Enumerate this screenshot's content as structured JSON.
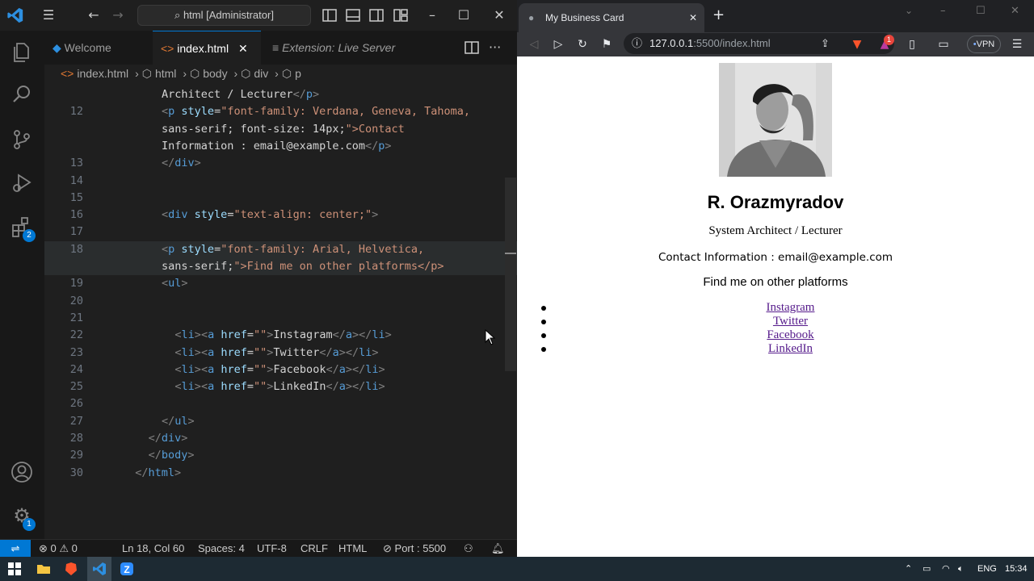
{
  "vscode": {
    "command_center": "html [Administrator]",
    "tabs": [
      {
        "label": "Welcome",
        "active": false
      },
      {
        "label": "index.html",
        "active": true
      },
      {
        "label": "Extension: Live Server",
        "active": false
      }
    ],
    "breadcrumb": [
      "index.html",
      "html",
      "body",
      "div",
      "p"
    ],
    "code_lines": [
      {
        "n": "",
        "text": "Architect / Lecturer</p>"
      },
      {
        "n": "12",
        "text": "<p style=\"font-family: Verdana, Geneva, Tahoma,"
      },
      {
        "n": "",
        "text": "sans-serif; font-size: 14px;\">Contact"
      },
      {
        "n": "",
        "text": "Information : email@example.com</p>"
      },
      {
        "n": "13",
        "text": "</div>"
      },
      {
        "n": "14",
        "text": ""
      },
      {
        "n": "15",
        "text": ""
      },
      {
        "n": "16",
        "text": "<div style=\"text-align: center;\">"
      },
      {
        "n": "17",
        "text": ""
      },
      {
        "n": "18",
        "text": "<p style=\"font-family: Arial, Helvetica,"
      },
      {
        "n": "",
        "text": "sans-serif;\">Find me on other platforms</p>"
      },
      {
        "n": "19",
        "text": "<ul>"
      },
      {
        "n": "20",
        "text": ""
      },
      {
        "n": "21",
        "text": ""
      },
      {
        "n": "22",
        "text": "<li><a href=\"\">Instagram</a></li>"
      },
      {
        "n": "23",
        "text": "<li><a href=\"\">Twitter</a></li>"
      },
      {
        "n": "24",
        "text": "<li><a href=\"\">Facebook</a></li>"
      },
      {
        "n": "25",
        "text": "<li><a href=\"\">LinkedIn</a></li>"
      },
      {
        "n": "26",
        "text": ""
      },
      {
        "n": "27",
        "text": "</ul>"
      },
      {
        "n": "28",
        "text": "</div>"
      },
      {
        "n": "29",
        "text": "</body>"
      },
      {
        "n": "30",
        "text": "</html>"
      }
    ],
    "status": {
      "errors": "0",
      "warnings": "0",
      "position": "Ln 18, Col 60",
      "spaces": "Spaces: 4",
      "encoding": "UTF-8",
      "eol": "CRLF",
      "language": "HTML",
      "port": "Port : 5500"
    },
    "badges": {
      "extensions": "2",
      "settings": "1"
    }
  },
  "browser": {
    "tab_title": "My Business Card",
    "url_host": "127.0.0.1",
    "url_rest": ":5500/index.html",
    "vpn_label": "VPN",
    "brave_badge": "1",
    "page": {
      "name": "R. Orazmyradov",
      "role": "System Architect / Lecturer",
      "contact": "Contact Information : email@example.com",
      "find": "Find me on other platforms",
      "links": [
        "Instagram",
        "Twitter",
        "Facebook",
        "LinkedIn"
      ]
    }
  },
  "taskbar": {
    "lang": "ENG",
    "time": "15:34"
  }
}
